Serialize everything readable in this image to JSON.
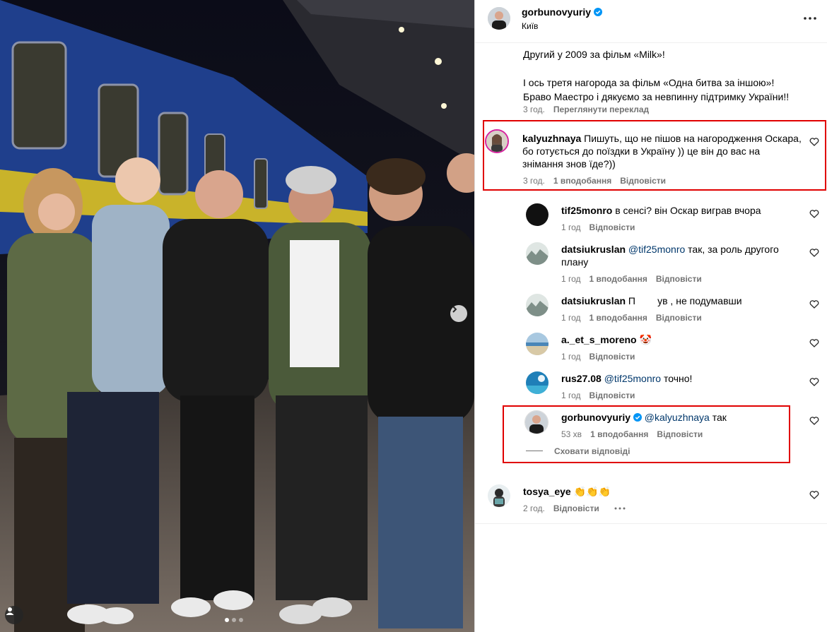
{
  "post": {
    "username": "gorbunovyuriy",
    "location": "Київ",
    "more_icon": "more-horizontal-icon",
    "caption_lines": [
      "Другий у 2009 за фільм «Milk»!",
      "",
      "І ось третя нагорода за фільм «Одна битва за іншою»!",
      "Браво Маестро і дякуємо за невпинну підтримку України!!"
    ],
    "caption_time": "3 год.",
    "caption_translate": "Переглянути переклад"
  },
  "photo": {
    "carousel_position": "1 of 3",
    "next_icon": "chevron-right-icon",
    "tag_icon": "user-tag-icon"
  },
  "comments": [
    {
      "username": "kalyuzhnaya",
      "text": "Пишуть, що не пішов на нагородження Оскара, бо готується до поїздки в Україну )) це він до вас на знімання знов їде?))",
      "time": "3 год.",
      "likes": "1 вподобання",
      "reply": "Відповісти",
      "highlighted": true
    }
  ],
  "replies": [
    {
      "username": "tif25monro",
      "mention": "",
      "text": "в сенсі? він Оскар виграв вчора",
      "time": "1 год",
      "likes": "",
      "reply": "Відповісти"
    },
    {
      "username": "datsiukruslan",
      "mention": "@tif25monro",
      "text": "так, за роль другого плану",
      "time": "1 год",
      "likes": "1 вподобання",
      "reply": "Відповісти"
    },
    {
      "username": "datsiukruslan",
      "mention": "",
      "text": "П        ув , не подумавши",
      "time": "1 год",
      "likes": "1 вподобання",
      "reply": "Відповісти"
    },
    {
      "username": "a._et_s_moreno",
      "mention": "",
      "text": "🤡",
      "time": "1 год",
      "likes": "",
      "reply": "Відповісти"
    },
    {
      "username": "rus27.08",
      "mention": "@tif25monro",
      "text": "точно!",
      "time": "1 год",
      "likes": "",
      "reply": "Відповісти"
    },
    {
      "username": "gorbunovyuriy",
      "mention": "@kalyuzhnaya",
      "text": "так",
      "time": "53 хв",
      "likes": "1 вподобання",
      "reply": "Відповісти",
      "verified": true,
      "highlighted": true
    }
  ],
  "hide_replies": "Сховати відповіді",
  "last_comment": {
    "username": "tosya_eye",
    "text": "👏👏👏",
    "time": "2 год.",
    "reply": "Відповісти"
  },
  "colors": {
    "accent_red": "#e00000",
    "verified_blue": "#0095f6",
    "meta_gray": "#737373",
    "mention_blue": "#00376b"
  }
}
